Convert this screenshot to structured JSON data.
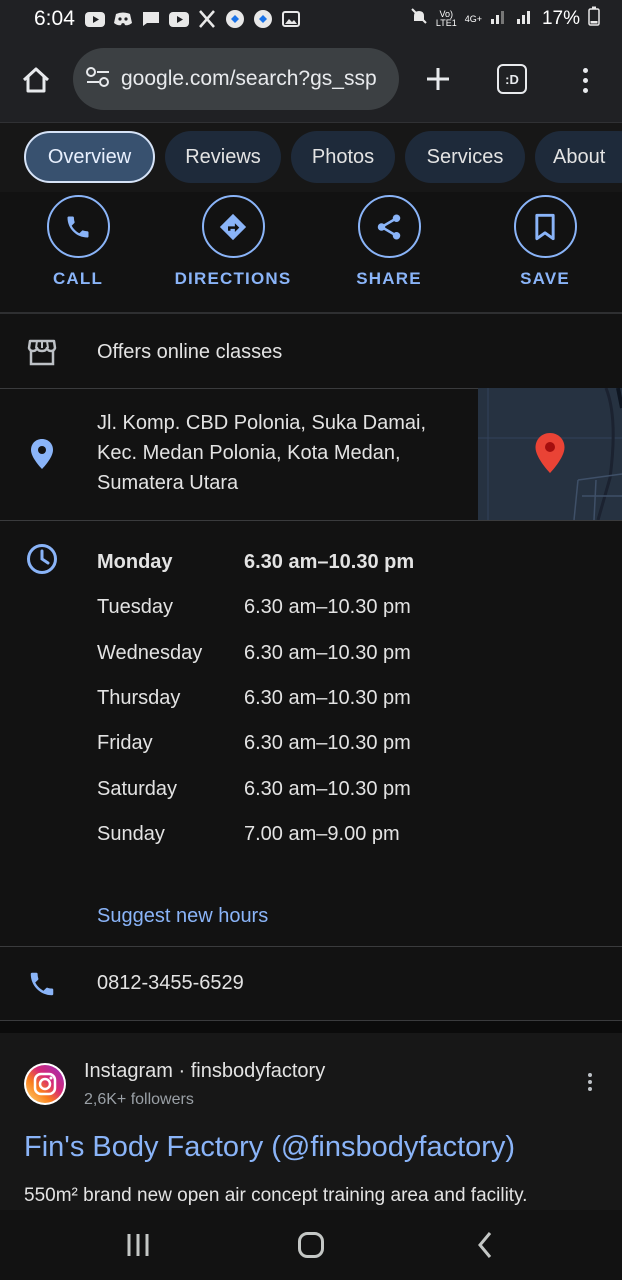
{
  "status_bar": {
    "time": "6:04",
    "network_top": "Vo)",
    "network_bottom": "LTE1",
    "network_type": "4G+",
    "battery": "17%"
  },
  "browser": {
    "url": "google.com/search?gs_ssp",
    "tab_count": ":D"
  },
  "tabs": [
    "Overview",
    "Reviews",
    "Photos",
    "Services",
    "About"
  ],
  "actions": {
    "call": "CALL",
    "directions": "DIRECTIONS",
    "share": "SHARE",
    "save": "SAVE"
  },
  "service_option": "Offers online classes",
  "address": {
    "line1": "Jl. Komp. CBD Polonia, Suka Damai,",
    "line2": "Kec. Medan Polonia, Kota Medan,",
    "line3": "Sumatera Utara"
  },
  "hours": [
    {
      "day": "Monday",
      "time": "6.30 am–10.30 pm"
    },
    {
      "day": "Tuesday",
      "time": "6.30 am–10.30 pm"
    },
    {
      "day": "Wednesday",
      "time": "6.30 am–10.30 pm"
    },
    {
      "day": "Thursday",
      "time": "6.30 am–10.30 pm"
    },
    {
      "day": "Friday",
      "time": "6.30 am–10.30 pm"
    },
    {
      "day": "Saturday",
      "time": "6.30 am–10.30 pm"
    },
    {
      "day": "Sunday",
      "time": "7.00 am–9.00 pm"
    }
  ],
  "suggest_hours": "Suggest new hours",
  "phone": "0812-3455-6529",
  "instagram": {
    "source": "Instagram · finsbodyfactory",
    "followers": "2,6K+ followers",
    "title": "Fin's Body Factory (@finsbodyfactory)",
    "snippet": "550m² brand new open air concept training area and facility."
  },
  "colors": {
    "accent": "#8ab4f8",
    "background": "#121212",
    "active_chip": "#38516f",
    "map_pin": "#ea4335"
  }
}
